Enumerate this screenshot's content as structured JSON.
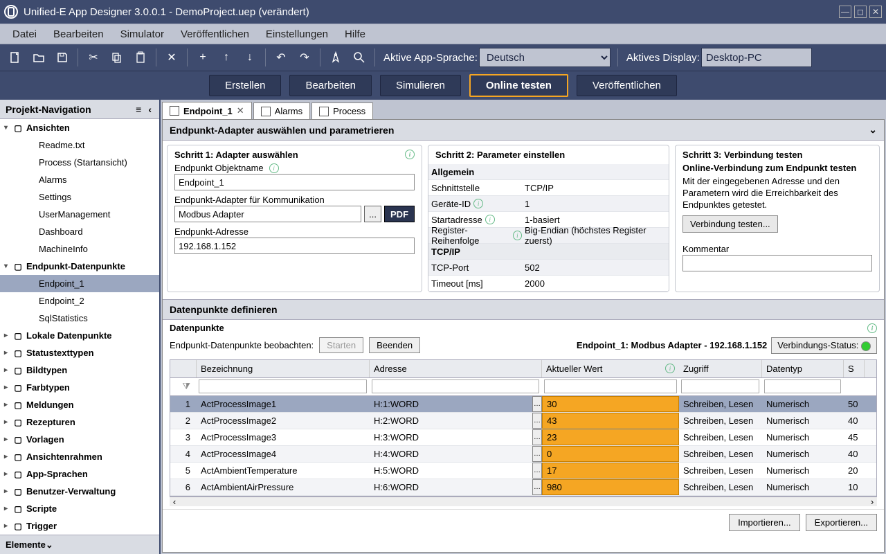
{
  "titlebar": {
    "title": "Unified-E App Designer 3.0.0.1 - DemoProject.uep  (verändert)"
  },
  "menu": [
    "Datei",
    "Bearbeiten",
    "Simulator",
    "Veröffentlichen",
    "Einstellungen",
    "Hilfe"
  ],
  "toolbar": {
    "lang_label": "Aktive App-Sprache:",
    "lang_value": "Deutsch",
    "display_label": "Aktives Display:",
    "display_value": "Desktop-PC"
  },
  "bigbuttons": [
    "Erstellen",
    "Bearbeiten",
    "Simulieren",
    "Online testen",
    "Veröffentlichen"
  ],
  "sidebar": {
    "header": "Projekt-Navigation",
    "footer": "Elemente",
    "tree": [
      {
        "label": "Ansichten",
        "lvl": 1,
        "exp": true
      },
      {
        "label": "Readme.txt",
        "lvl": 2
      },
      {
        "label": "Process (Startansicht)",
        "lvl": 2
      },
      {
        "label": "Alarms",
        "lvl": 2
      },
      {
        "label": "Settings",
        "lvl": 2
      },
      {
        "label": "UserManagement",
        "lvl": 2
      },
      {
        "label": "Dashboard",
        "lvl": 2
      },
      {
        "label": "MachineInfo",
        "lvl": 2
      },
      {
        "label": "Endpunkt-Datenpunkte",
        "lvl": 1,
        "exp": true
      },
      {
        "label": "Endpoint_1",
        "lvl": 2,
        "sel": true
      },
      {
        "label": "Endpoint_2",
        "lvl": 2
      },
      {
        "label": "SqlStatistics",
        "lvl": 2
      },
      {
        "label": "Lokale Datenpunkte",
        "lvl": 1
      },
      {
        "label": "Statustexttypen",
        "lvl": 1
      },
      {
        "label": "Bildtypen",
        "lvl": 1
      },
      {
        "label": "Farbtypen",
        "lvl": 1
      },
      {
        "label": "Meldungen",
        "lvl": 1
      },
      {
        "label": "Rezepturen",
        "lvl": 1
      },
      {
        "label": "Vorlagen",
        "lvl": 1
      },
      {
        "label": "Ansichtenrahmen",
        "lvl": 1
      },
      {
        "label": "App-Sprachen",
        "lvl": 1
      },
      {
        "label": "Benutzer-Verwaltung",
        "lvl": 1
      },
      {
        "label": "Scripte",
        "lvl": 1
      },
      {
        "label": "Trigger",
        "lvl": 1
      }
    ]
  },
  "tabs": [
    {
      "label": "Endpoint_1",
      "close": true,
      "active": true
    },
    {
      "label": "Alarms"
    },
    {
      "label": "Process"
    }
  ],
  "section1": {
    "title": "Endpunkt-Adapter auswählen und parametrieren",
    "step1": {
      "title": "Schritt 1: Adapter auswählen",
      "objname_label": "Endpunkt Objektname",
      "objname_value": "Endpoint_1",
      "adapter_label": "Endpunkt-Adapter für Kommunikation",
      "adapter_value": "Modbus Adapter",
      "pdf": "PDF",
      "addr_label": "Endpunkt-Adresse",
      "addr_value": "192.168.1.152"
    },
    "step2": {
      "title": "Schritt 2: Parameter einstellen",
      "groups": [
        {
          "h": "Allgemein",
          "rows": [
            {
              "l": "Schnittstelle",
              "v": "TCP/IP"
            },
            {
              "l": "Geräte-ID",
              "v": "1",
              "i": true
            },
            {
              "l": "Startadresse",
              "v": "1-basiert",
              "i": true
            },
            {
              "l": "Register-Reihenfolge",
              "v": "Big-Endian (höchstes Register zuerst)",
              "i": true
            }
          ]
        },
        {
          "h": "TCP/IP",
          "rows": [
            {
              "l": "TCP-Port",
              "v": "502"
            },
            {
              "l": "Timeout [ms]",
              "v": "2000"
            }
          ]
        }
      ]
    },
    "step3": {
      "title": "Schritt 3: Verbindung testen",
      "sub": "Online-Verbindung zum Endpunkt testen",
      "desc": "Mit der eingegebenen Adresse und den Parametern wird die Erreichbarkeit des Endpunktes getestet.",
      "btn": "Verbindung testen...",
      "comment_label": "Kommentar"
    }
  },
  "section2": {
    "title": "Datenpunkte definieren",
    "sub": "Datenpunkte",
    "watch_label": "Endpunkt-Datenpunkte beobachten:",
    "start": "Starten",
    "stop": "Beenden",
    "info": "Endpoint_1: Modbus Adapter - 192.168.1.152",
    "status_label": "Verbindungs-Status:",
    "cols": [
      "Bezeichnung",
      "Adresse",
      "Aktueller Wert",
      "Zugriff",
      "Datentyp",
      "S"
    ],
    "rows": [
      {
        "n": 1,
        "b": "ActProcessImage1",
        "a": "H:1:WORD",
        "w": "30",
        "z": "Schreiben, Lesen",
        "d": "Numerisch",
        "s": "50",
        "sel": true
      },
      {
        "n": 2,
        "b": "ActProcessImage2",
        "a": "H:2:WORD",
        "w": "43",
        "z": "Schreiben, Lesen",
        "d": "Numerisch",
        "s": "40"
      },
      {
        "n": 3,
        "b": "ActProcessImage3",
        "a": "H:3:WORD",
        "w": "23",
        "z": "Schreiben, Lesen",
        "d": "Numerisch",
        "s": "45"
      },
      {
        "n": 4,
        "b": "ActProcessImage4",
        "a": "H:4:WORD",
        "w": "0",
        "z": "Schreiben, Lesen",
        "d": "Numerisch",
        "s": "40"
      },
      {
        "n": 5,
        "b": "ActAmbientTemperature",
        "a": "H:5:WORD",
        "w": "17",
        "z": "Schreiben, Lesen",
        "d": "Numerisch",
        "s": "20"
      },
      {
        "n": 6,
        "b": "ActAmbientAirPressure",
        "a": "H:6:WORD",
        "w": "980",
        "z": "Schreiben, Lesen",
        "d": "Numerisch",
        "s": "10"
      }
    ],
    "import": "Importieren...",
    "export": "Exportieren..."
  }
}
